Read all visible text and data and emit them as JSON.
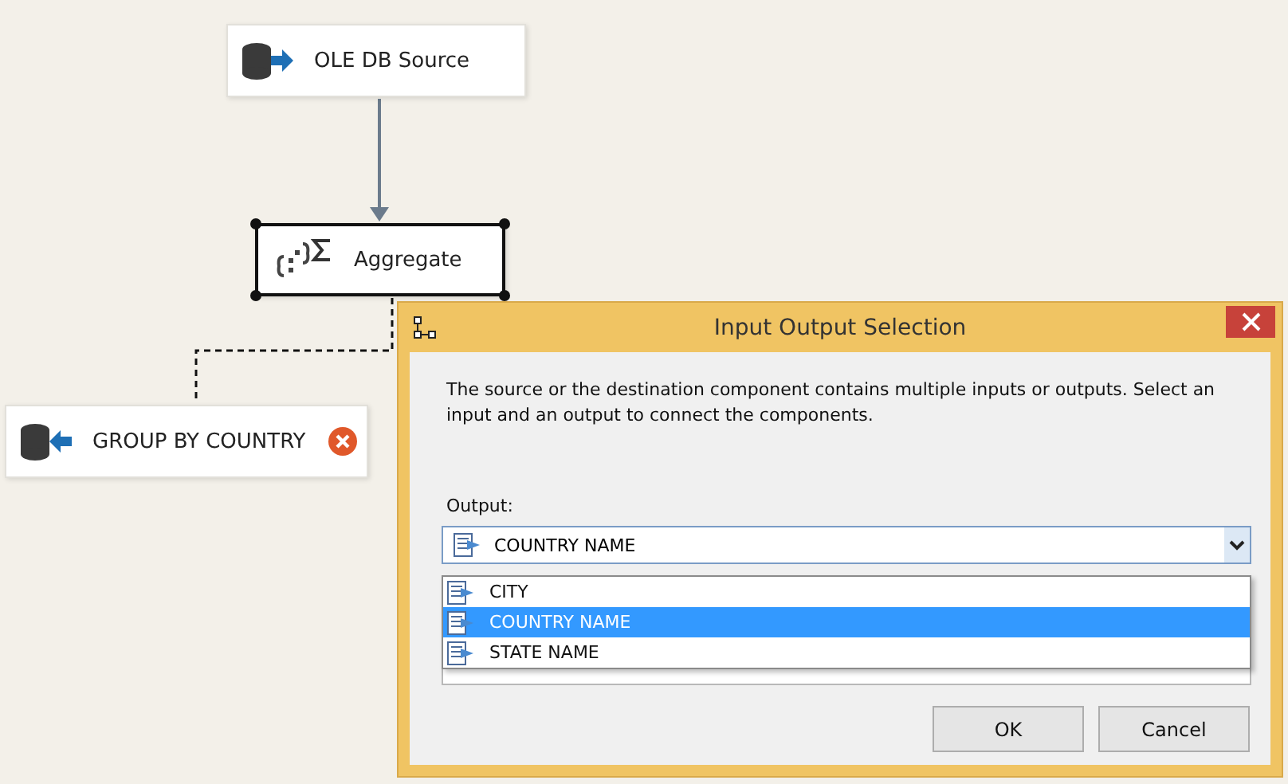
{
  "canvas": {
    "nodes": [
      {
        "label": "OLE DB Source",
        "kind": "source",
        "selected": false,
        "error": false
      },
      {
        "label": "Aggregate",
        "kind": "aggregate",
        "selected": true,
        "error": false
      },
      {
        "label": "GROUP BY COUNTRY",
        "kind": "destination",
        "selected": false,
        "error": true
      }
    ]
  },
  "dialog": {
    "title": "Input Output Selection",
    "message": "The source or the destination component contains multiple inputs or outputs. Select an input and an output to connect the components.",
    "output": {
      "label": "Output:",
      "value": "COUNTRY NAME",
      "options": [
        {
          "label": "CITY",
          "selected": false
        },
        {
          "label": "COUNTRY NAME",
          "selected": true
        },
        {
          "label": "STATE NAME",
          "selected": false
        }
      ]
    },
    "buttons": [
      "OK",
      "Cancel"
    ]
  }
}
